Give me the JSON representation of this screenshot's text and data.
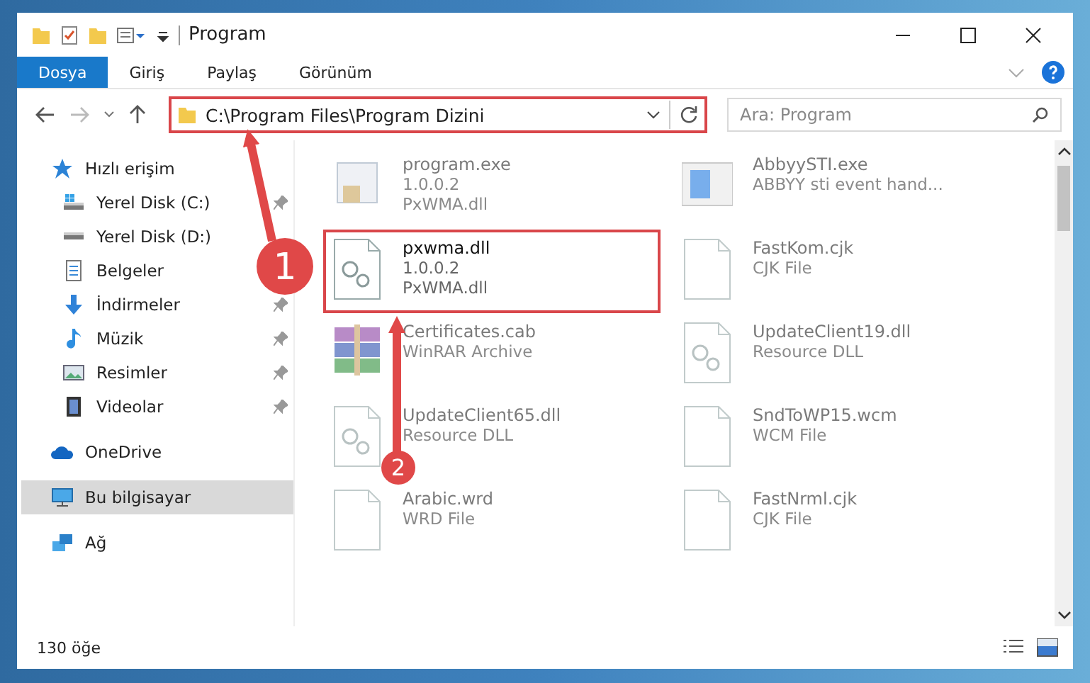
{
  "window": {
    "title": "Program"
  },
  "ribbon_tabs": [
    {
      "label": "Dosya",
      "selected": true
    },
    {
      "label": "Giriş",
      "selected": false
    },
    {
      "label": "Paylaş",
      "selected": false
    },
    {
      "label": "Görünüm",
      "selected": false
    }
  ],
  "address": {
    "path": "C:\\Program Files\\Program Dizini",
    "highlighted": true
  },
  "search": {
    "placeholder": "Ara: Program"
  },
  "sidebar": {
    "items": [
      {
        "label": "Hızlı erişim",
        "kind": "star",
        "selected": false,
        "children": [
          {
            "label": "Yerel Disk (C:)",
            "kind": "drive-os",
            "pinned": true,
            "selected": false
          },
          {
            "label": "Yerel Disk (D:)",
            "kind": "drive",
            "pinned": false,
            "selected": false
          },
          {
            "label": "Belgeler",
            "kind": "documents",
            "pinned": false,
            "selected": false
          },
          {
            "label": "İndirmeler",
            "kind": "downloads",
            "pinned": true,
            "selected": false
          },
          {
            "label": "Müzik",
            "kind": "music",
            "pinned": true,
            "selected": false
          },
          {
            "label": "Resimler",
            "kind": "pictures",
            "pinned": true,
            "selected": false
          },
          {
            "label": "Videolar",
            "kind": "videos",
            "pinned": true,
            "selected": false
          }
        ]
      },
      {
        "label": "OneDrive",
        "kind": "cloud",
        "selected": false
      },
      {
        "label": "Bu bilgisayar",
        "kind": "computer",
        "selected": true
      },
      {
        "label": "Ağ",
        "kind": "network",
        "selected": false
      }
    ]
  },
  "files": [
    {
      "name": "program.exe",
      "details": [
        "1.0.0.2",
        "PxWMA.dll"
      ],
      "kind": "exe",
      "blurred": true,
      "highlighted": false
    },
    {
      "name": "AbbyySTI.exe",
      "details": [
        "ABBYY sti event hand..."
      ],
      "kind": "app",
      "blurred": true,
      "highlighted": false
    },
    {
      "name": "pxwma.dll",
      "details": [
        "1.0.0.2",
        "PxWMA.dll"
      ],
      "kind": "dll",
      "blurred": false,
      "highlighted": true
    },
    {
      "name": "FastKom.cjk",
      "details": [
        "CJK File"
      ],
      "kind": "doc",
      "blurred": true,
      "highlighted": false
    },
    {
      "name": "Certificates.cab",
      "details": [
        "WinRAR Archive"
      ],
      "kind": "archive",
      "blurred": true,
      "highlighted": false
    },
    {
      "name": "UpdateClient19.dll",
      "details": [
        "Resource DLL"
      ],
      "kind": "dll",
      "blurred": true,
      "highlighted": false
    },
    {
      "name": "UpdateClient65.dll",
      "details": [
        "Resource DLL"
      ],
      "kind": "dll",
      "blurred": true,
      "highlighted": false
    },
    {
      "name": "SndToWP15.wcm",
      "details": [
        "WCM File"
      ],
      "kind": "doc",
      "blurred": true,
      "highlighted": false
    },
    {
      "name": "Arabic.wrd",
      "details": [
        "WRD File"
      ],
      "kind": "doc",
      "blurred": true,
      "highlighted": false
    },
    {
      "name": "FastNrml.cjk",
      "details": [
        "CJK File"
      ],
      "kind": "doc",
      "blurred": true,
      "highlighted": false
    }
  ],
  "status_bar": {
    "count": "130 öğe"
  },
  "callouts": [
    {
      "number": "1"
    },
    {
      "number": "2"
    }
  ]
}
